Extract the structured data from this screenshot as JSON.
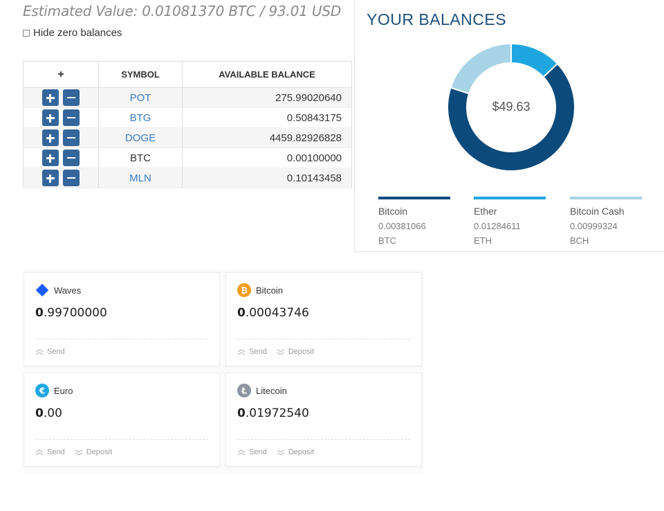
{
  "estimated_value": "Estimated Value: 0.01081370 BTC / 93.01 USD",
  "hide_zero_label": "Hide zero balances",
  "table": {
    "head_action": "+",
    "head_symbol": "SYMBOL",
    "head_balance": "AVAILABLE BALANCE",
    "rows": [
      {
        "symbol": "POT",
        "balance": "275.99020640"
      },
      {
        "symbol": "BTG",
        "balance": "0.50843175"
      },
      {
        "symbol": "DOGE",
        "balance": "4459.82926828"
      },
      {
        "symbol": "BTC",
        "balance": "0.00100000"
      },
      {
        "symbol": "MLN",
        "balance": "0.10143458"
      }
    ]
  },
  "panel": {
    "title": "YOUR BALANCES",
    "total": "$49.63",
    "legend": [
      {
        "name": "Bitcoin",
        "amount": "0.00381066",
        "symbol": "BTC",
        "color": "#0d4a7c"
      },
      {
        "name": "Ether",
        "amount": "0.01284611",
        "symbol": "ETH",
        "color": "#1fa6e0"
      },
      {
        "name": "Bitcoin Cash",
        "amount": "0.00999324",
        "symbol": "BCH",
        "color": "#a8d3e6"
      }
    ]
  },
  "chart_data": {
    "type": "pie",
    "categories": [
      "Bitcoin",
      "Ether",
      "Bitcoin Cash"
    ],
    "values": [
      0.67,
      0.13,
      0.2
    ],
    "colors": [
      "#0d4a7c",
      "#1fa6e0",
      "#a8d3e6"
    ]
  },
  "cards": [
    {
      "name": "Waves",
      "amount_bold": "0",
      "amount_rest": ".99700000",
      "icon": "waves-icon",
      "send": "Send",
      "deposit": ""
    },
    {
      "name": "Bitcoin",
      "amount_bold": "0",
      "amount_rest": ".00043746",
      "icon": "bitcoin-icon",
      "send": "Send",
      "deposit": "Deposit"
    },
    {
      "name": "Euro",
      "amount_bold": "0",
      "amount_rest": ".00",
      "icon": "euro-icon",
      "send": "Send",
      "deposit": "Deposit"
    },
    {
      "name": "Litecoin",
      "amount_bold": "0",
      "amount_rest": ".01972540",
      "icon": "litecoin-icon",
      "send": "Send",
      "deposit": "Deposit"
    }
  ]
}
